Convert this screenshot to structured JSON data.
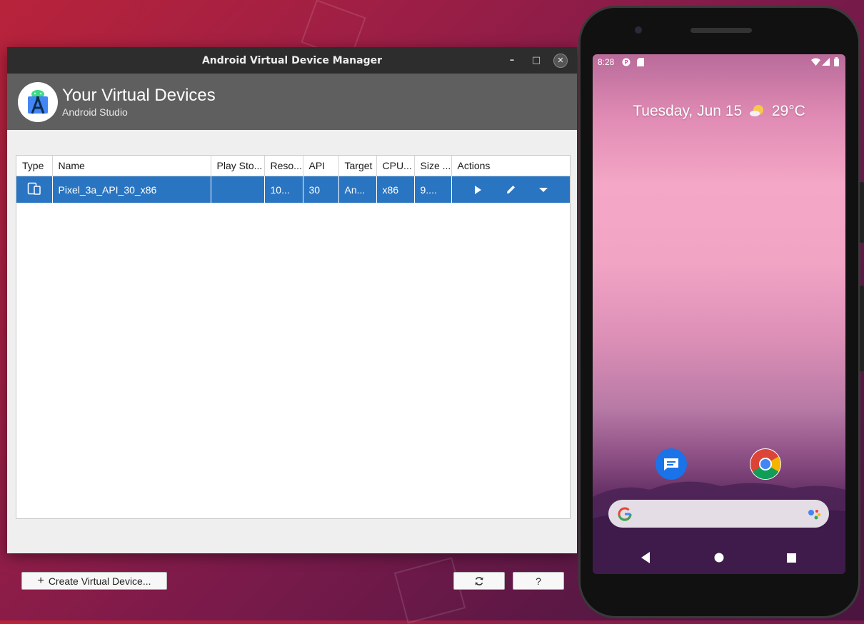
{
  "window": {
    "title": "Android Virtual Device Manager",
    "controls": {
      "minimize": "–",
      "maximize": "□",
      "close": "✕"
    }
  },
  "header": {
    "title": "Your Virtual Devices",
    "subtitle": "Android Studio"
  },
  "table": {
    "columns": [
      "Type",
      "Name",
      "Play Sto...",
      "Reso...",
      "API",
      "Target",
      "CPU...",
      "Size ...",
      "Actions"
    ],
    "rows": [
      {
        "type_icon": "phone-tablet-icon",
        "name": "Pixel_3a_API_30_x86",
        "play_store": "",
        "resolution": "10...",
        "api": "30",
        "target": "An...",
        "cpu": "x86",
        "size": "9....",
        "actions": [
          "play-icon",
          "pencil-icon",
          "chevron-down-icon"
        ]
      }
    ]
  },
  "buttons": {
    "create": "Create Virtual Device...",
    "create_icon": "+",
    "refresh_icon": "refresh-icon",
    "help": "?"
  },
  "colors": {
    "selection": "#2a75c2",
    "titlebar": "#2d2d2d",
    "banner": "#5f5f5f"
  },
  "emulator": {
    "status_time": "8:28",
    "date_text": "Tuesday, Jun 15",
    "temperature": "29°C",
    "apps": [
      "messages-icon",
      "chrome-icon"
    ],
    "search_icons": [
      "google-g-icon",
      "assistant-icon"
    ],
    "nav": [
      "back-icon",
      "home-icon",
      "recents-icon"
    ]
  }
}
